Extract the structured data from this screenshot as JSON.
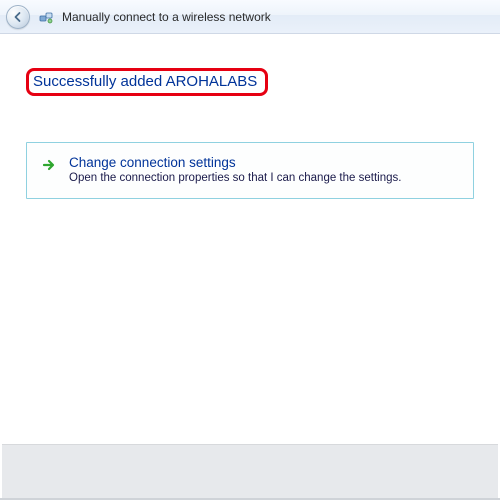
{
  "header": {
    "title": "Manually connect to a wireless network"
  },
  "main": {
    "success_message": "Successfully added AROHALABS",
    "option": {
      "title": "Change connection settings",
      "description": "Open the connection properties so that I can change the settings."
    }
  },
  "colors": {
    "accent_link": "#003399",
    "highlight_border": "#e60012",
    "card_border": "#8fd1e0"
  }
}
